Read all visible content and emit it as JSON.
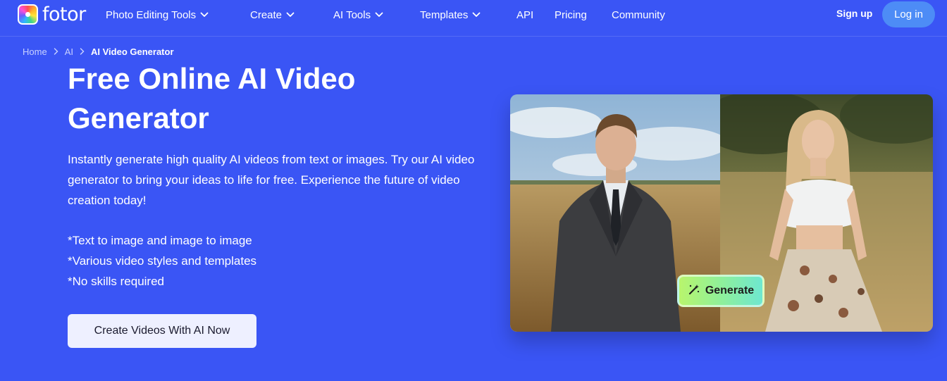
{
  "brand": {
    "name": "fotor"
  },
  "nav": {
    "items": [
      {
        "label": "Photo Editing Tools",
        "dropdown": true
      },
      {
        "label": "Create",
        "dropdown": true
      },
      {
        "label": "AI Tools",
        "dropdown": true
      },
      {
        "label": "Templates",
        "dropdown": true
      },
      {
        "label": "API",
        "dropdown": false
      },
      {
        "label": "Pricing",
        "dropdown": false
      },
      {
        "label": "Community",
        "dropdown": false
      }
    ],
    "signup": "Sign up",
    "login": "Log in"
  },
  "breadcrumb": [
    "Home",
    "AI",
    "AI Video Generator"
  ],
  "hero": {
    "title": "Free Online AI Video Generator",
    "description": "Instantly generate high quality AI videos from text or images. Try our AI video generator to bring your ideas to life for free. Experience the future of video creation today!",
    "bullets": [
      "*Text to image and image to image",
      "*Various video styles and templates",
      "*No skills required"
    ],
    "cta": "Create Videos With AI Now",
    "generate_label": "Generate"
  },
  "colors": {
    "background": "#3a55f5",
    "login_button": "#4d8cf6",
    "cta_background": "#eef0ff"
  },
  "icons": [
    "chevron-down-icon",
    "chevron-right-icon",
    "magic-wand-icon"
  ]
}
